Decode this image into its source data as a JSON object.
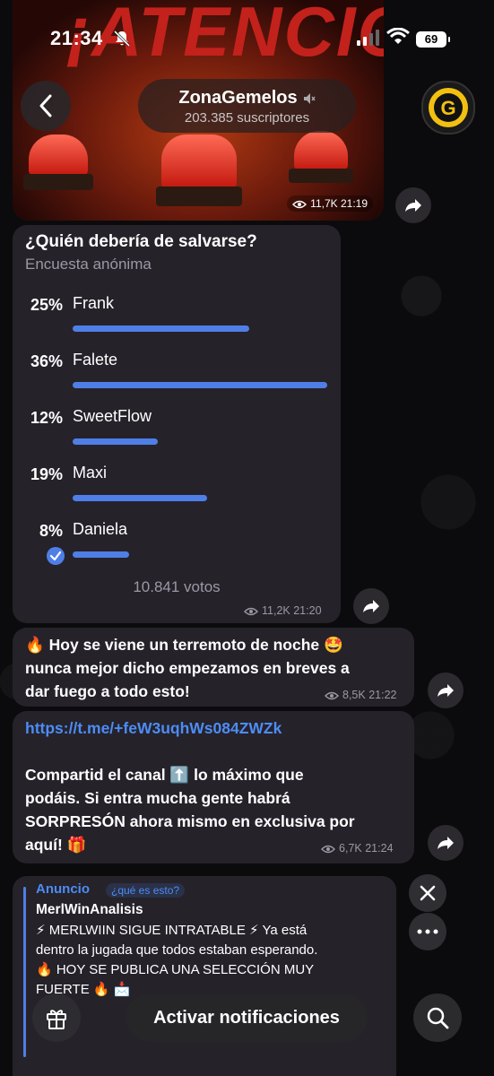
{
  "status_bar": {
    "time": "21:34",
    "battery": "69"
  },
  "header": {
    "channel_name": "ZonaGemelos",
    "subscribers": "203.385 suscriptores",
    "logo_letter": "G"
  },
  "media_post": {
    "banner_text": "¡ATENCIÓN!",
    "views": "11,7K",
    "time": "21:19"
  },
  "poll": {
    "question": "¿Quién debería de salvarse?",
    "type": "Encuesta anónima",
    "options": [
      {
        "label": "Frank",
        "percent": "25%",
        "fraction": 0.25
      },
      {
        "label": "Falete",
        "percent": "36%",
        "fraction": 0.36
      },
      {
        "label": "SweetFlow",
        "percent": "12%",
        "fraction": 0.12
      },
      {
        "label": "Maxi",
        "percent": "19%",
        "fraction": 0.19
      },
      {
        "label": "Daniela",
        "percent": "8%",
        "fraction": 0.08,
        "selected": true
      }
    ],
    "votes": "10.841 votos",
    "views": "11,2K",
    "time": "21:20"
  },
  "messages": [
    {
      "text_html_parts": [
        "🔥 Hoy se viene un terremoto de noche 🤩",
        "nunca mejor dicho empezamos en breves a",
        "dar fuego a todo esto!"
      ],
      "views": "8,5K",
      "time": "21:22"
    },
    {
      "link": "https://t.me/+feW3uqhWs084ZWZk",
      "lines": [
        "Compartid el canal ⬆️ lo máximo que",
        "podáis. Si entra mucha gente habrá",
        "SORPRESÓN ahora mismo en exclusiva por",
        "aquí! 🎁"
      ],
      "views": "6,7K",
      "time": "21:24"
    }
  ],
  "ad": {
    "label": "Anuncio",
    "what_is_this": "¿qué es esto?",
    "title": "MerlWinAnalisis",
    "body_lines": [
      "⚡ MERLWIIN SIGUE INTRATABLE ⚡ Ya está",
      "dentro la jugada que todos estaban esperando.",
      "🔥 HOY SE PUBLICA UNA SELECCIÓN MUY",
      "FUERTE 🔥 📩"
    ]
  },
  "bottom_bar": {
    "notify_label": "Activar notificaciones"
  },
  "colors": {
    "accent": "#4f7fe6",
    "link": "#4d8cf5",
    "bubble": "#25222a",
    "background": "#0b0b0d"
  }
}
